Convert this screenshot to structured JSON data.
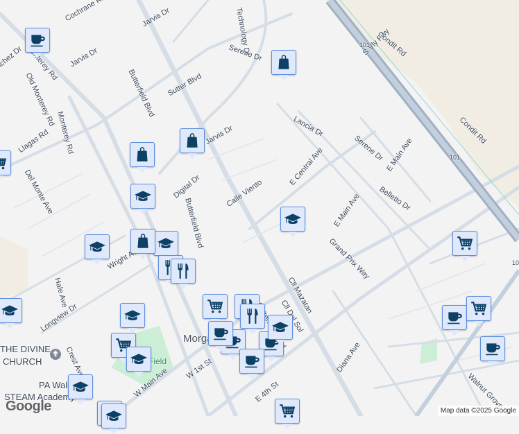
{
  "map": {
    "place_label": "Morgan Hill",
    "labels": [
      "Cochrane Rd",
      "Jarvis Dr",
      "Jarvis Dr",
      "Monterey Rd",
      "Old Monterey Rd",
      "Monterey Rd",
      "Sanchez Dr",
      "Llagas Rd",
      "Del Monte Ave",
      "Butterfield Blvd",
      "Sutter Blvd",
      "Serene Dr",
      "Jarvis Dr",
      "Digital Dr",
      "Butterfield Blvd",
      "Calle Viento",
      "E Central Ave",
      "Lancia Dr",
      "Serene Dr",
      "E Main Ave",
      "Belletto Dr",
      "E Main Ave",
      "Grand Prix Way",
      "Cll Mazatan",
      "Cll Del Sol",
      "Butterfield Blvd",
      "Diana Ave",
      "Walnut Grove Dr",
      "Condit Rd",
      "Condit Rd",
      "S Vly Fwy",
      "Hale Ave",
      "Longview Dr",
      "Crest Ave",
      "W Main Ave",
      "W 1st St",
      "E 4th St",
      "Wright Ave",
      "Technology Dr",
      "101",
      "101",
      "101"
    ],
    "poi": [
      "THE DIVINE",
      "CHURCH",
      "PA Walden",
      "STEAM Academy",
      "Field"
    ],
    "markers": [
      "coffee",
      "bag",
      "bag",
      "bag",
      "graduation-cap",
      "cart",
      "graduation-cap",
      "graduation-cap",
      "bag",
      "graduation-cap",
      "fork-knife",
      "fork-knife",
      "graduation-cap",
      "cart",
      "graduation-cap",
      "graduation-cap",
      "cart",
      "cart",
      "cart",
      "fork-knife",
      "fork-knife",
      "coffee",
      "coffee",
      "graduation-cap",
      "coffee",
      "coffee",
      "coffee",
      "cart",
      "coffee",
      "graduation-cap",
      "graduation-cap",
      "cart"
    ],
    "google_logo": "Google",
    "attribution": "Map data ©2025 Google"
  },
  "colors": {
    "marker_fill": "#dfe9fb",
    "marker_border": "#5b8ee0",
    "icon": "#0d4065",
    "freeway": "#a9b8c9",
    "park": "#cdeed6"
  }
}
